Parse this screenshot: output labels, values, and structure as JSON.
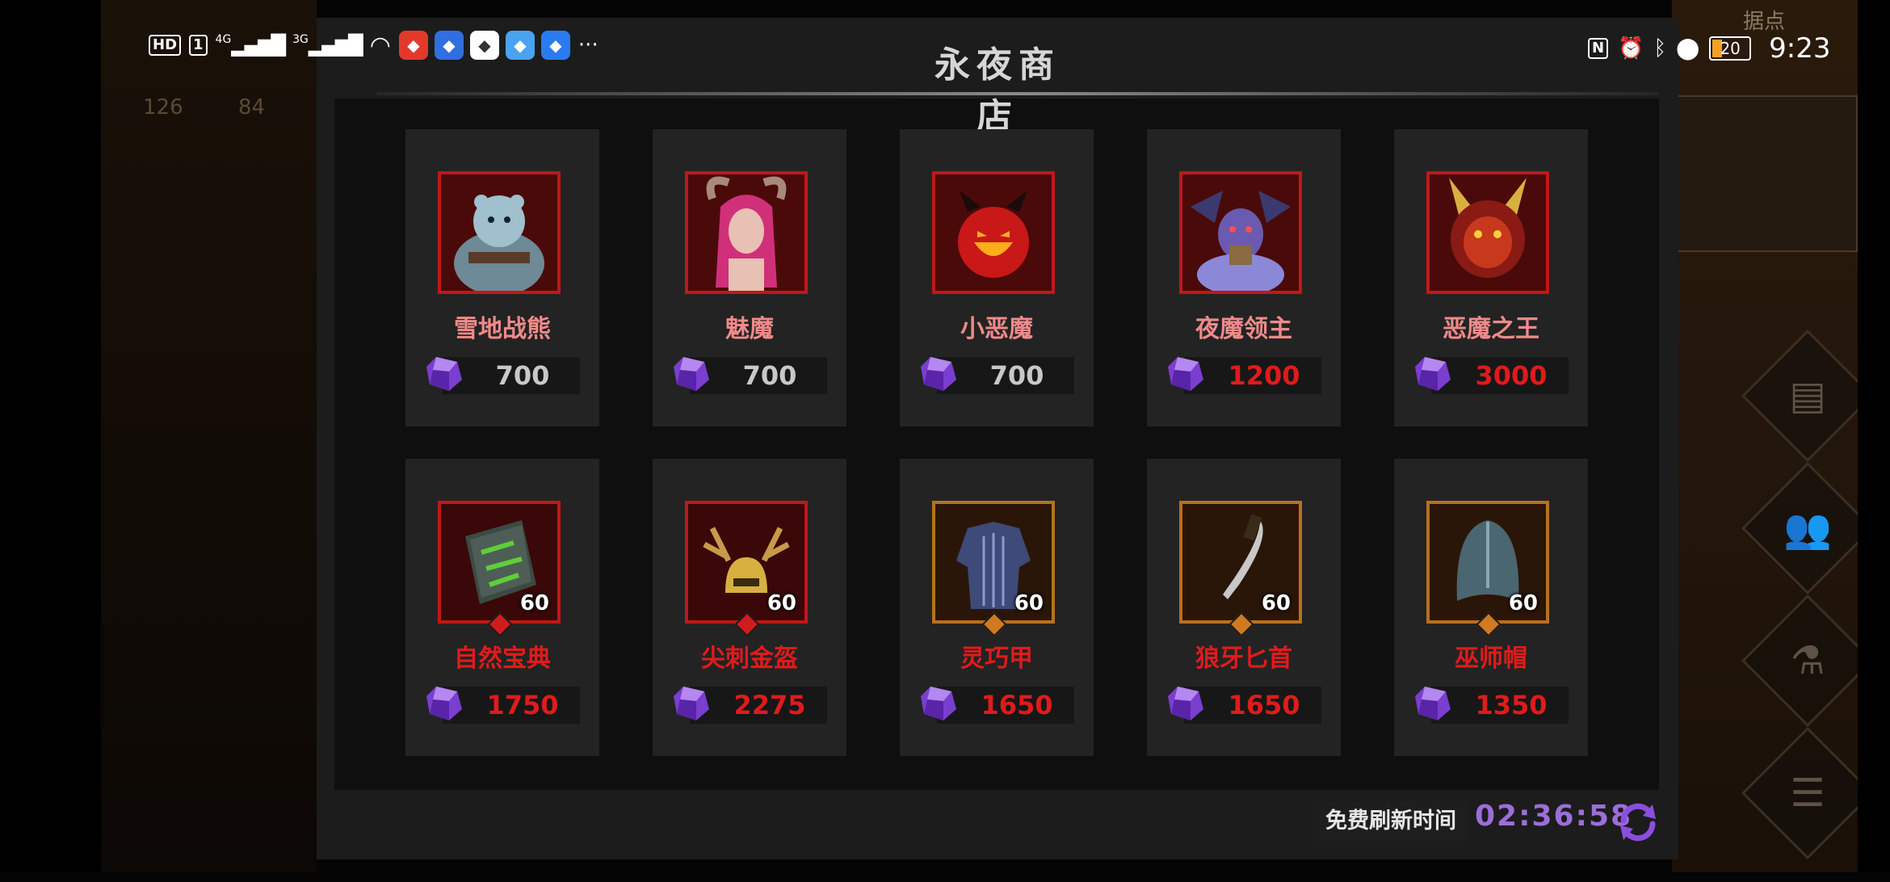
{
  "statusbar": {
    "hd_label": "HD",
    "sim_label": "1",
    "net1": "4G",
    "net2": "3G",
    "more": "···",
    "nfc": "N",
    "battery_level": "20",
    "time": "9:23",
    "app_icons": [
      {
        "name": "taobao-app-icon",
        "color": "#e23a2a"
      },
      {
        "name": "u-app-icon",
        "color": "#2f6fe0"
      },
      {
        "name": "ball-app-icon",
        "color": "#ffffff"
      },
      {
        "name": "puzzle-app-icon",
        "color": "#4aa3f0"
      },
      {
        "name": "bulb-app-icon",
        "color": "#2a7bf0"
      }
    ]
  },
  "background": {
    "left_stats": [
      "126",
      "84"
    ],
    "minimap_label": "据点"
  },
  "shop": {
    "title": "永夜商店",
    "refresh_label": "免费刷新时间",
    "refresh_timer": "02:36:58",
    "colors": {
      "affordable": "#c8c8c8",
      "unaffordable": "#e01b1b",
      "hero_name": "#f08a8a",
      "red_frame": "#c01818",
      "gold_frame": "#b8701e",
      "gem": "#8a4ee0"
    },
    "items": [
      {
        "name": "雪地战熊",
        "price": "700",
        "price_state": "affordable",
        "frame": "red",
        "icon": "snow-bear-portrait-icon",
        "level": ""
      },
      {
        "name": "魅魔",
        "price": "700",
        "price_state": "affordable",
        "frame": "red",
        "icon": "succubus-portrait-icon",
        "level": ""
      },
      {
        "name": "小恶魔",
        "price": "700",
        "price_state": "affordable",
        "frame": "red",
        "icon": "imp-portrait-icon",
        "level": ""
      },
      {
        "name": "夜魔领主",
        "price": "1200",
        "price_state": "unaffordable",
        "frame": "red",
        "icon": "night-demon-lord-portrait-icon",
        "level": ""
      },
      {
        "name": "恶魔之王",
        "price": "3000",
        "price_state": "unaffordable",
        "frame": "red",
        "icon": "demon-king-portrait-icon",
        "level": ""
      },
      {
        "name": "自然宝典",
        "price": "1750",
        "price_state": "unaffordable",
        "frame": "red",
        "icon": "nature-tome-icon",
        "level": "60"
      },
      {
        "name": "尖刺金盔",
        "price": "2275",
        "price_state": "unaffordable",
        "frame": "red",
        "icon": "spiked-gold-helm-icon",
        "level": "60"
      },
      {
        "name": "灵巧甲",
        "price": "1650",
        "price_state": "unaffordable",
        "frame": "gold",
        "icon": "agile-armor-icon",
        "level": "60"
      },
      {
        "name": "狼牙匕首",
        "price": "1650",
        "price_state": "unaffordable",
        "frame": "gold",
        "icon": "wolf-fang-dagger-icon",
        "level": "60"
      },
      {
        "name": "巫师帽",
        "price": "1350",
        "price_state": "unaffordable",
        "frame": "gold",
        "icon": "wizard-hat-icon",
        "level": "60"
      }
    ]
  }
}
